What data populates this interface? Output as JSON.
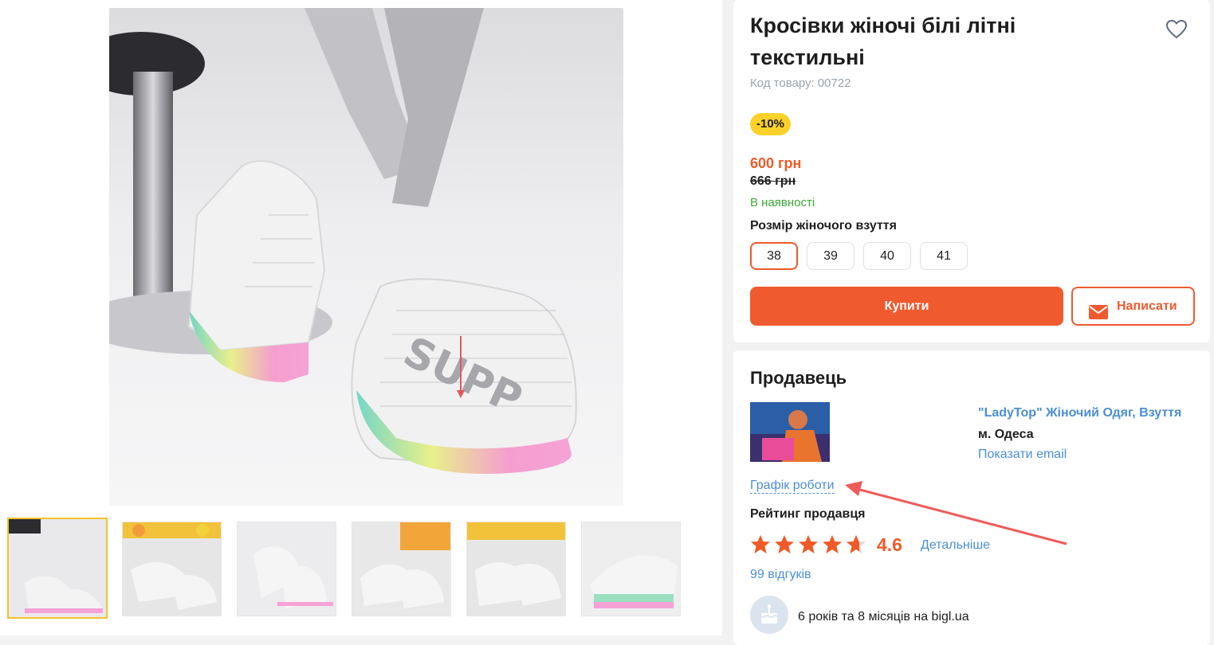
{
  "product": {
    "title": "Кросівки жіночі білі літні текстильні",
    "sku_label": "Код товару:",
    "sku": "00722",
    "discount": "-10%",
    "price_current": "600 грн",
    "price_old": "666 грн",
    "availability": "В наявності",
    "size_label": "Розмір жіночого взуття",
    "sizes": [
      "38",
      "39",
      "40",
      "41"
    ],
    "selected_size": "38",
    "buy_label": "Купити",
    "write_label": "Написати"
  },
  "seller": {
    "heading": "Продавець",
    "name": "\"LadyTop\" Жіночий Одяг, Взуття",
    "city": "м. Одеса",
    "show_email": "Показати email",
    "schedule": "Графік роботи",
    "rating_label": "Рейтинг продавця",
    "rating": "4.6",
    "rating_stars": 4.6,
    "details": "Детальніше",
    "reviews": "99 відгуків",
    "tenure": "6 років та 8 місяців на bigl.ua"
  },
  "gallery": {
    "thumbnail_count": 6,
    "active_index": 0
  },
  "colors": {
    "accent": "#f05a2f",
    "link": "#4a8ed6",
    "badge": "#fcd12a",
    "in_stock": "#3aaa35",
    "annotation": "#ef5b5b"
  },
  "icons": {
    "favorite": "heart-icon",
    "message": "mail-icon",
    "tenure": "cake-icon"
  }
}
